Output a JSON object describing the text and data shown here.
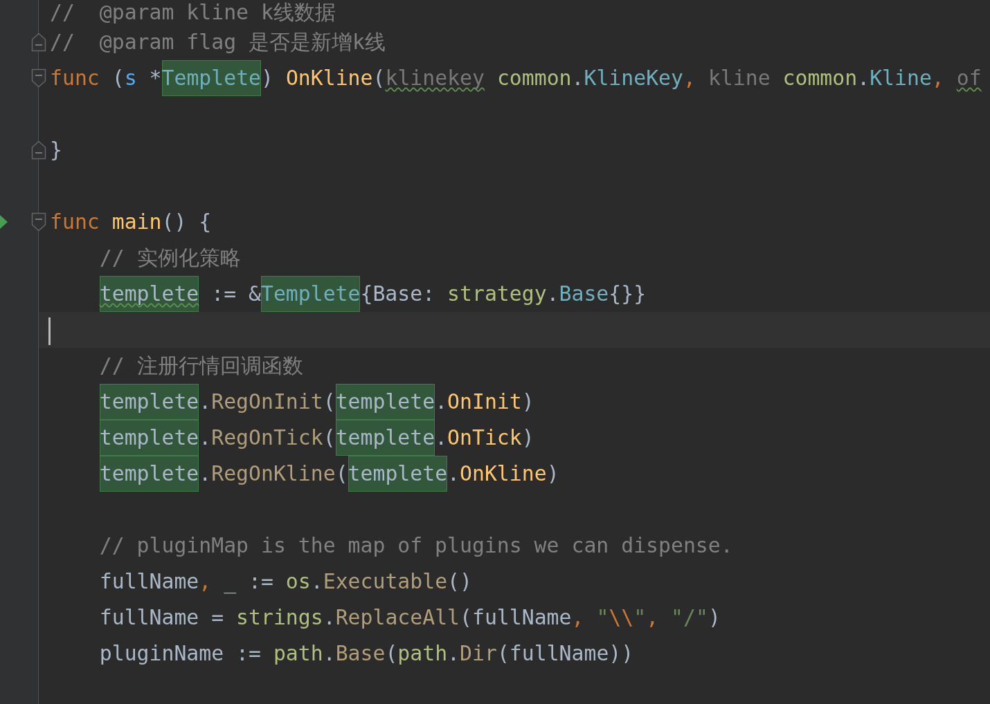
{
  "editor": {
    "lines": [
      {
        "kind": "code",
        "tokens": [
          {
            "text": "//  @param kline k线数据",
            "kind": "comment",
            "highlighted": false,
            "warning": false
          }
        ]
      },
      {
        "kind": "code",
        "gutter": [
          {
            "kind": "fold_end"
          }
        ],
        "tokens": [
          {
            "text": "//  @param flag 是否是新增k线",
            "kind": "comment",
            "highlighted": false,
            "warning": false
          }
        ]
      },
      {
        "kind": "code",
        "gutter": [
          {
            "kind": "fold_start"
          }
        ],
        "tokens": [
          {
            "text": "func",
            "kind": "keyword",
            "highlighted": false,
            "warning": false
          },
          {
            "text": " (",
            "kind": "plain",
            "highlighted": false,
            "warning": false
          },
          {
            "text": "s",
            "kind": "receiver",
            "highlighted": false,
            "warning": false
          },
          {
            "text": " *",
            "kind": "plain",
            "highlighted": false,
            "warning": false
          },
          {
            "text": "Templete",
            "kind": "type",
            "highlighted": true,
            "warning": false
          },
          {
            "text": ") ",
            "kind": "plain",
            "highlighted": false,
            "warning": false
          },
          {
            "text": "OnKline",
            "kind": "function",
            "highlighted": false,
            "warning": false
          },
          {
            "text": "(",
            "kind": "plain",
            "highlighted": false,
            "warning": false
          },
          {
            "text": "klinekey",
            "kind": "unused",
            "highlighted": false,
            "warning": true
          },
          {
            "text": " common",
            "kind": "package",
            "highlighted": false,
            "warning": false
          },
          {
            "text": ".",
            "kind": "plain",
            "highlighted": false,
            "warning": false
          },
          {
            "text": "KlineKey",
            "kind": "type",
            "highlighted": false,
            "warning": false
          },
          {
            "text": ", ",
            "kind": "comma",
            "highlighted": false,
            "warning": false
          },
          {
            "text": "kline",
            "kind": "unused",
            "highlighted": false,
            "warning": false
          },
          {
            "text": " common",
            "kind": "package",
            "highlighted": false,
            "warning": false
          },
          {
            "text": ".",
            "kind": "plain",
            "highlighted": false,
            "warning": false
          },
          {
            "text": "Kline",
            "kind": "type",
            "highlighted": false,
            "warning": false
          },
          {
            "text": ", ",
            "kind": "comma",
            "highlighted": false,
            "warning": false
          },
          {
            "text": "of",
            "kind": "unused",
            "highlighted": false,
            "warning": true
          }
        ]
      },
      {
        "kind": "code"
      },
      {
        "kind": "code",
        "gutter": [
          {
            "kind": "fold_end"
          }
        ],
        "tokens": [
          {
            "text": "}",
            "kind": "plain",
            "highlighted": false,
            "warning": false
          }
        ]
      },
      {
        "kind": "code"
      },
      {
        "kind": "code",
        "gutter": [
          {
            "kind": "run"
          },
          {
            "kind": "fold_start"
          }
        ],
        "tokens": [
          {
            "text": "func ",
            "kind": "keyword",
            "highlighted": false,
            "warning": false
          },
          {
            "text": "main",
            "kind": "function",
            "highlighted": false,
            "warning": false
          },
          {
            "text": "() {",
            "kind": "plain",
            "highlighted": false,
            "warning": false
          }
        ],
        "children": [
          {
            "kind": "code",
            "tokens": [
              {
                "text": "// 实例化策略",
                "kind": "comment",
                "highlighted": false,
                "warning": false
              }
            ]
          },
          {
            "kind": "code",
            "tokens": [
              {
                "text": "templete",
                "kind": "variable",
                "highlighted": true,
                "warning": true
              },
              {
                "text": " := &",
                "kind": "plain",
                "highlighted": false,
                "warning": false
              },
              {
                "text": "Templete",
                "kind": "type",
                "highlighted": true,
                "warning": false
              },
              {
                "text": "{Base: ",
                "kind": "plain",
                "highlighted": false,
                "warning": false
              },
              {
                "text": "strategy",
                "kind": "package",
                "highlighted": false,
                "warning": false
              },
              {
                "text": ".",
                "kind": "plain",
                "highlighted": false,
                "warning": false
              },
              {
                "text": "Base",
                "kind": "type",
                "highlighted": false,
                "warning": false
              },
              {
                "text": "{}}",
                "kind": "plain",
                "highlighted": false,
                "warning": false
              }
            ]
          },
          {
            "kind": "current_line"
          },
          {
            "kind": "code",
            "tokens": [
              {
                "text": "// 注册行情回调函数",
                "kind": "comment",
                "highlighted": false,
                "warning": false
              }
            ]
          },
          {
            "kind": "code",
            "tokens": [
              {
                "text": "templete",
                "kind": "variable",
                "highlighted": true,
                "warning": false
              },
              {
                "text": ".",
                "kind": "plain",
                "highlighted": false,
                "warning": false
              },
              {
                "text": "RegOnInit",
                "kind": "method",
                "highlighted": false,
                "warning": false
              },
              {
                "text": "(",
                "kind": "plain",
                "highlighted": false,
                "warning": false
              },
              {
                "text": "templete",
                "kind": "variable",
                "highlighted": true,
                "warning": false
              },
              {
                "text": ".",
                "kind": "plain",
                "highlighted": false,
                "warning": false
              },
              {
                "text": "OnInit",
                "kind": "funcref",
                "highlighted": false,
                "warning": false
              },
              {
                "text": ")",
                "kind": "plain",
                "highlighted": false,
                "warning": false
              }
            ]
          },
          {
            "kind": "code",
            "tokens": [
              {
                "text": "templete",
                "kind": "variable",
                "highlighted": true,
                "warning": false
              },
              {
                "text": ".",
                "kind": "plain",
                "highlighted": false,
                "warning": false
              },
              {
                "text": "RegOnTick",
                "kind": "method",
                "highlighted": false,
                "warning": false
              },
              {
                "text": "(",
                "kind": "plain",
                "highlighted": false,
                "warning": false
              },
              {
                "text": "templete",
                "kind": "variable",
                "highlighted": true,
                "warning": false
              },
              {
                "text": ".",
                "kind": "plain",
                "highlighted": false,
                "warning": false
              },
              {
                "text": "OnTick",
                "kind": "funcref",
                "highlighted": false,
                "warning": false
              },
              {
                "text": ")",
                "kind": "plain",
                "highlighted": false,
                "warning": false
              }
            ]
          },
          {
            "kind": "code",
            "tokens": [
              {
                "text": "templete",
                "kind": "variable",
                "highlighted": true,
                "warning": false
              },
              {
                "text": ".",
                "kind": "plain",
                "highlighted": false,
                "warning": false
              },
              {
                "text": "RegOnKline",
                "kind": "method",
                "highlighted": false,
                "warning": false
              },
              {
                "text": "(",
                "kind": "plain",
                "highlighted": false,
                "warning": false
              },
              {
                "text": "templete",
                "kind": "variable",
                "highlighted": true,
                "warning": false
              },
              {
                "text": ".",
                "kind": "plain",
                "highlighted": false,
                "warning": false
              },
              {
                "text": "OnKline",
                "kind": "funcref",
                "highlighted": false,
                "warning": false
              },
              {
                "text": ")",
                "kind": "plain",
                "highlighted": false,
                "warning": false
              }
            ]
          },
          {
            "kind": "code"
          },
          {
            "kind": "code",
            "tokens": [
              {
                "text": "// pluginMap is the map of plugins we can dispense.",
                "kind": "comment",
                "highlighted": false,
                "warning": false
              }
            ]
          },
          {
            "kind": "code",
            "tokens": [
              {
                "text": "fullName",
                "kind": "plain",
                "highlighted": false,
                "warning": false
              },
              {
                "text": ", ",
                "kind": "comma",
                "highlighted": false,
                "warning": false
              },
              {
                "text": "_ := ",
                "kind": "plain",
                "highlighted": false,
                "warning": false
              },
              {
                "text": "os",
                "kind": "package",
                "highlighted": false,
                "warning": false
              },
              {
                "text": ".",
                "kind": "plain",
                "highlighted": false,
                "warning": false
              },
              {
                "text": "Executable",
                "kind": "method",
                "highlighted": false,
                "warning": false
              },
              {
                "text": "()",
                "kind": "plain",
                "highlighted": false,
                "warning": false
              }
            ]
          },
          {
            "kind": "code",
            "tokens": [
              {
                "text": "fullName = ",
                "kind": "plain",
                "highlighted": false,
                "warning": false
              },
              {
                "text": "strings",
                "kind": "package",
                "highlighted": false,
                "warning": false
              },
              {
                "text": ".",
                "kind": "plain",
                "highlighted": false,
                "warning": false
              },
              {
                "text": "ReplaceAll",
                "kind": "method",
                "highlighted": false,
                "warning": false
              },
              {
                "text": "(fullName",
                "kind": "plain",
                "highlighted": false,
                "warning": false
              },
              {
                "text": ", ",
                "kind": "comma",
                "highlighted": false,
                "warning": false
              },
              {
                "text": "\"",
                "kind": "string",
                "highlighted": false,
                "warning": false
              },
              {
                "text": "\\\\",
                "kind": "escape",
                "highlighted": false,
                "warning": false
              },
              {
                "text": "\"",
                "kind": "string",
                "highlighted": false,
                "warning": false
              },
              {
                "text": ", ",
                "kind": "comma",
                "highlighted": false,
                "warning": false
              },
              {
                "text": "\"/\"",
                "kind": "string",
                "highlighted": false,
                "warning": false
              },
              {
                "text": ")",
                "kind": "plain",
                "highlighted": false,
                "warning": false
              }
            ]
          },
          {
            "kind": "code",
            "tokens": [
              {
                "text": "pluginName := ",
                "kind": "plain",
                "highlighted": false,
                "warning": false
              },
              {
                "text": "path",
                "kind": "package",
                "highlighted": false,
                "warning": false
              },
              {
                "text": ".",
                "kind": "plain",
                "highlighted": false,
                "warning": false
              },
              {
                "text": "Base",
                "kind": "method",
                "highlighted": false,
                "warning": false
              },
              {
                "text": "(",
                "kind": "plain",
                "highlighted": false,
                "warning": false
              },
              {
                "text": "path",
                "kind": "package",
                "highlighted": false,
                "warning": false
              },
              {
                "text": ".",
                "kind": "plain",
                "highlighted": false,
                "warning": false
              },
              {
                "text": "Dir",
                "kind": "method",
                "highlighted": false,
                "warning": false
              },
              {
                "text": "(fullName))",
                "kind": "plain",
                "highlighted": false,
                "warning": false
              }
            ]
          },
          {
            "kind": "code"
          }
        ]
      }
    ]
  }
}
